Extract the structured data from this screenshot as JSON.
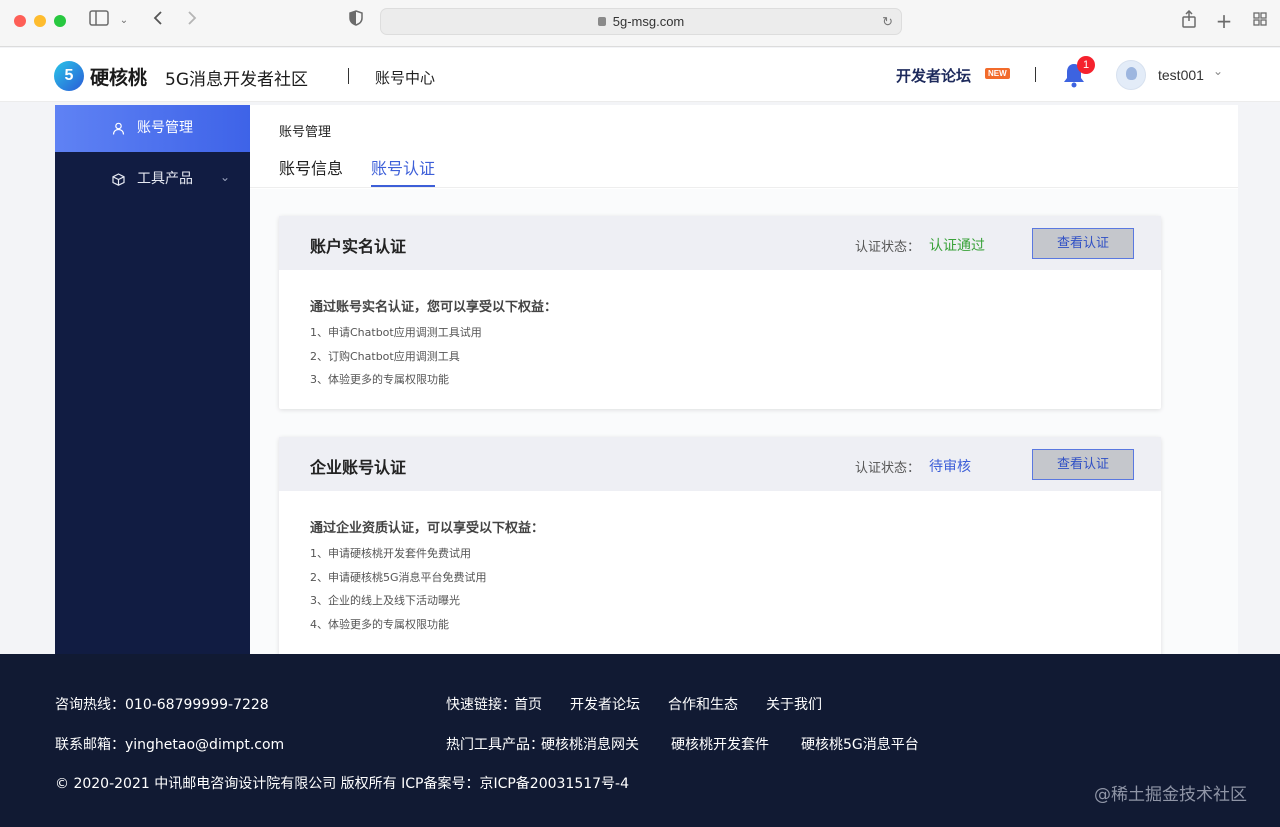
{
  "browser": {
    "url": "5g-msg.com"
  },
  "header": {
    "logo_mark": "5",
    "brand": "硬核桃",
    "brand_sub": "5G消息开发者社区",
    "section": "账号中心",
    "forum_link": "开发者论坛",
    "new_badge": "NEW",
    "notification_count": "1",
    "username": "test001"
  },
  "sidebar": {
    "items": [
      {
        "label": "账号管理",
        "icon": "user-icon",
        "active": true
      },
      {
        "label": "工具产品",
        "icon": "cube-icon",
        "active": false
      }
    ]
  },
  "main": {
    "breadcrumb": "账号管理",
    "tabs": [
      {
        "label": "账号信息",
        "active": false
      },
      {
        "label": "账号认证",
        "active": true
      }
    ],
    "cards": [
      {
        "title": "账户实名认证",
        "status_label": "认证状态：",
        "status_value": "认证通过",
        "button": "查看认证",
        "intro": "通过账号实名认证，您可以享受以下权益：",
        "benefits": [
          "1、申请Chatbot应用调测工具试用",
          "2、订购Chatbot应用调测工具",
          "3、体验更多的专属权限功能"
        ]
      },
      {
        "title": "企业账号认证",
        "status_label": "认证状态：",
        "status_value": "待审核",
        "button": "查看认证",
        "intro": "通过企业资质认证，可以享受以下权益：",
        "benefits": [
          "1、申请硬核桃开发套件免费试用",
          "2、申请硬核桃5G消息平台免费试用",
          "3、企业的线上及线下活动曝光",
          "4、体验更多的专属权限功能"
        ]
      }
    ]
  },
  "footer": {
    "hotline": "咨询热线：010-68799999-7228",
    "email": "联系邮箱：yinghetao@dimpt.com",
    "copyright": "© 2020-2021 中讯邮电咨询设计院有限公司 版权所有 ICP备案号：京ICP备20031517号-4",
    "quick_links_label": "快速链接：",
    "quick_links": [
      "首页",
      "开发者论坛",
      "合作和生态",
      "关于我们"
    ],
    "hot_tools_label": "热门工具产品：",
    "hot_tools": [
      "硬核桃消息网关",
      "硬核桃开发套件",
      "硬核桃5G消息平台"
    ]
  },
  "watermark": "@稀土掘金技术社区",
  "colors": {
    "accent": "#3d5fd8",
    "sidebar_bg": "#111c42",
    "footer_bg": "#111a33",
    "status_ok": "#3aa23a"
  }
}
